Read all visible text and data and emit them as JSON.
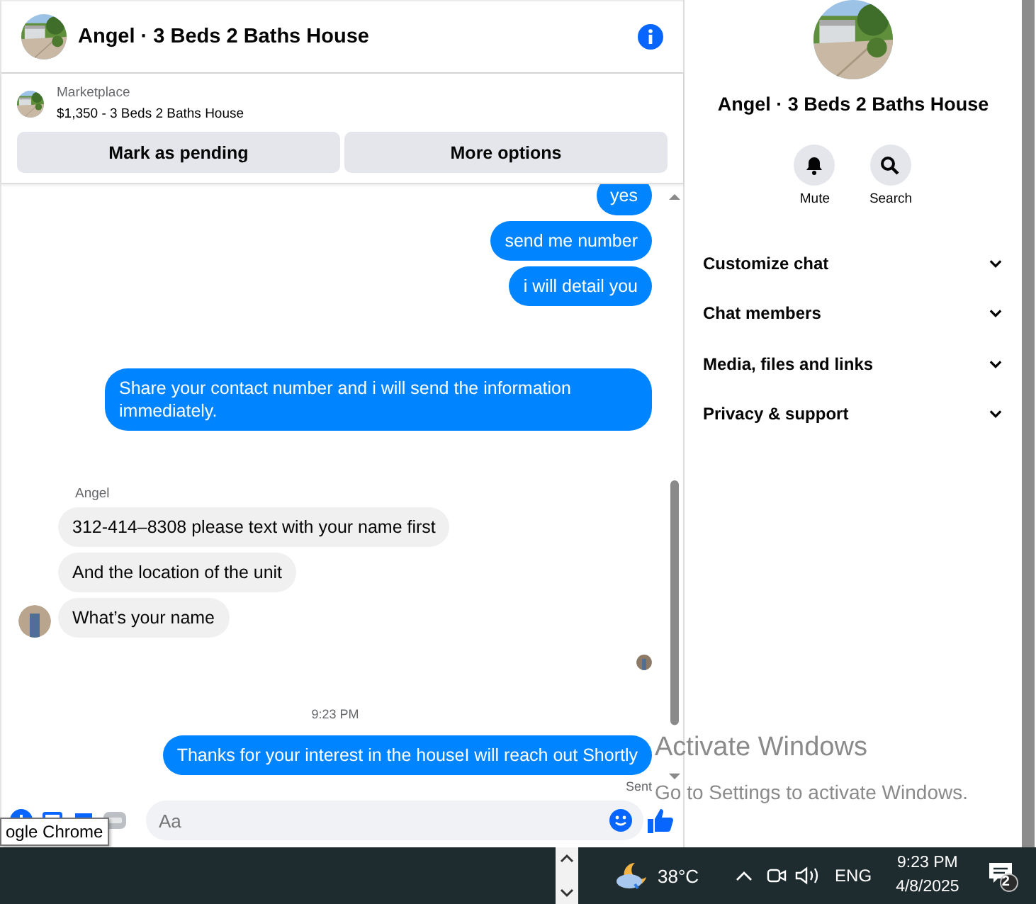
{
  "chat": {
    "title": "Angel · 3 Beds 2 Baths House",
    "listing": {
      "source": "Marketplace",
      "summary": "$1,350 - 3 Beds 2 Baths House"
    },
    "actions": [
      "Mark as pending",
      "More options"
    ],
    "messages": [
      {
        "kind": "outgoing",
        "text": "yes"
      },
      {
        "kind": "outgoing",
        "text": "send me number"
      },
      {
        "kind": "outgoing",
        "text": "i will detail you"
      },
      {
        "kind": "gap"
      },
      {
        "kind": "outgoing",
        "text": "Share your contact number and i will send the information immediately."
      },
      {
        "kind": "gap"
      },
      {
        "kind": "sender",
        "text": "Angel"
      },
      {
        "kind": "incoming",
        "text": "312-414–8308 please text with your name first",
        "avatar": false
      },
      {
        "kind": "incoming",
        "text": "And the location of the unit",
        "avatar": false
      },
      {
        "kind": "incoming",
        "text": "What’s your name",
        "avatar": true
      },
      {
        "kind": "seen"
      },
      {
        "kind": "time",
        "text": "9:23 PM"
      },
      {
        "kind": "outgoing",
        "text": "Thanks for your interest in the houseI will reach out Shortly"
      },
      {
        "kind": "status",
        "text": "Sent"
      }
    ],
    "composer": {
      "placeholder": "Aa"
    }
  },
  "details": {
    "title": "Angel · 3 Beds 2 Baths House",
    "actions": [
      {
        "kind": "mute",
        "label": "Mute"
      },
      {
        "kind": "search",
        "label": "Search"
      }
    ],
    "sections": [
      {
        "label": "Customize chat",
        "expanded": false
      },
      {
        "label": "Chat members",
        "expanded": false
      },
      {
        "label": "Media, files and links",
        "expanded": false
      },
      {
        "label": "Privacy & support",
        "expanded": false
      }
    ]
  },
  "tooltip": "ogle Chrome",
  "activation": {
    "title": "Activate Windows",
    "hint": "Go to Settings to activate Windows."
  },
  "taskbar": {
    "temperature": "38°C",
    "language": "ENG",
    "time": "9:23 PM",
    "date": "4/8/2025",
    "notifications": "2"
  }
}
